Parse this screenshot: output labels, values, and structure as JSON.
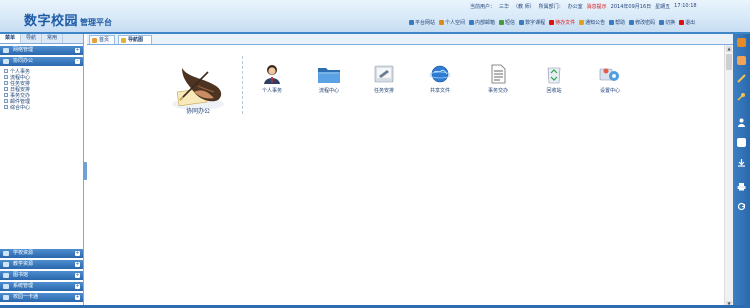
{
  "header": {
    "logo_main": "数字校园",
    "logo_sub": "管理平台",
    "user_label": "当前用户：",
    "user_name": "三华",
    "role": "（教 师）",
    "dept_label": "所属部门：",
    "dept_name": "办公室",
    "red_note": "消息提示",
    "date": "2014年09月16日",
    "weekday": "星期五",
    "time": "17:10:18"
  },
  "quicklinks": [
    {
      "label": "平台网站",
      "icon": "home-icon",
      "color": "#3a7ac0"
    },
    {
      "label": "个人空间",
      "icon": "user-icon",
      "color": "#d88b18"
    },
    {
      "label": "内部邮箱",
      "icon": "mail-icon",
      "color": "#3a7ac0"
    },
    {
      "label": "短信",
      "icon": "sms-icon",
      "color": "#4a9a3d"
    },
    {
      "label": "数字课程",
      "icon": "book-icon",
      "color": "#3a7ac0"
    },
    {
      "label": "待办文件",
      "icon": "file-icon",
      "color": "#d11",
      "red": true
    },
    {
      "label": "通知公告",
      "icon": "notice-icon",
      "color": "#e0a020"
    },
    {
      "label": "帮助",
      "icon": "help-icon",
      "color": "#3a7ac0"
    },
    {
      "label": "修改密码",
      "icon": "key-icon",
      "color": "#3a7ac0"
    },
    {
      "label": "切换",
      "icon": "switch-icon",
      "color": "#3a7ac0"
    },
    {
      "label": "退出",
      "icon": "exit-icon",
      "color": "#d11"
    }
  ],
  "sidebar": {
    "tabs": [
      "菜单",
      "导航",
      "常用"
    ],
    "top_sections": [
      {
        "label": "网络管理"
      },
      {
        "label": "协同办公"
      }
    ],
    "subitems": [
      "个人事务",
      "流程中心",
      "任务安排",
      "日程安排",
      "事务交办",
      "邮件管理",
      "综合中心"
    ],
    "bottom_sections": [
      {
        "label": "学校资源"
      },
      {
        "label": "教学资源"
      },
      {
        "label": "图书馆"
      },
      {
        "label": "系统管理"
      },
      {
        "label": "校园一卡通"
      }
    ]
  },
  "main_tabs": [
    "首页",
    "导航图"
  ],
  "content": {
    "office_label": "协同办公",
    "icons": [
      {
        "label": "个人事务",
        "icon": "person-icon"
      },
      {
        "label": "流程中心",
        "icon": "folder-icon"
      },
      {
        "label": "任务安排",
        "icon": "task-icon"
      },
      {
        "label": "共享文件",
        "icon": "globe-icon"
      },
      {
        "label": "事务交办",
        "icon": "document-icon"
      },
      {
        "label": "回收站",
        "icon": "recycle-bin-icon"
      },
      {
        "label": "设置中心",
        "icon": "settings-icon"
      }
    ]
  },
  "rightbar": {
    "icons": [
      "cube-icon",
      "eraser-icon",
      "pencil-icon",
      "key-icon",
      "users-icon",
      "note-icon",
      "download-icon",
      "printer-icon",
      "refresh-icon"
    ]
  },
  "colors": {
    "accent": "#2a67ad",
    "header_bg": "#d8e9f8",
    "alert_red": "#d11"
  }
}
